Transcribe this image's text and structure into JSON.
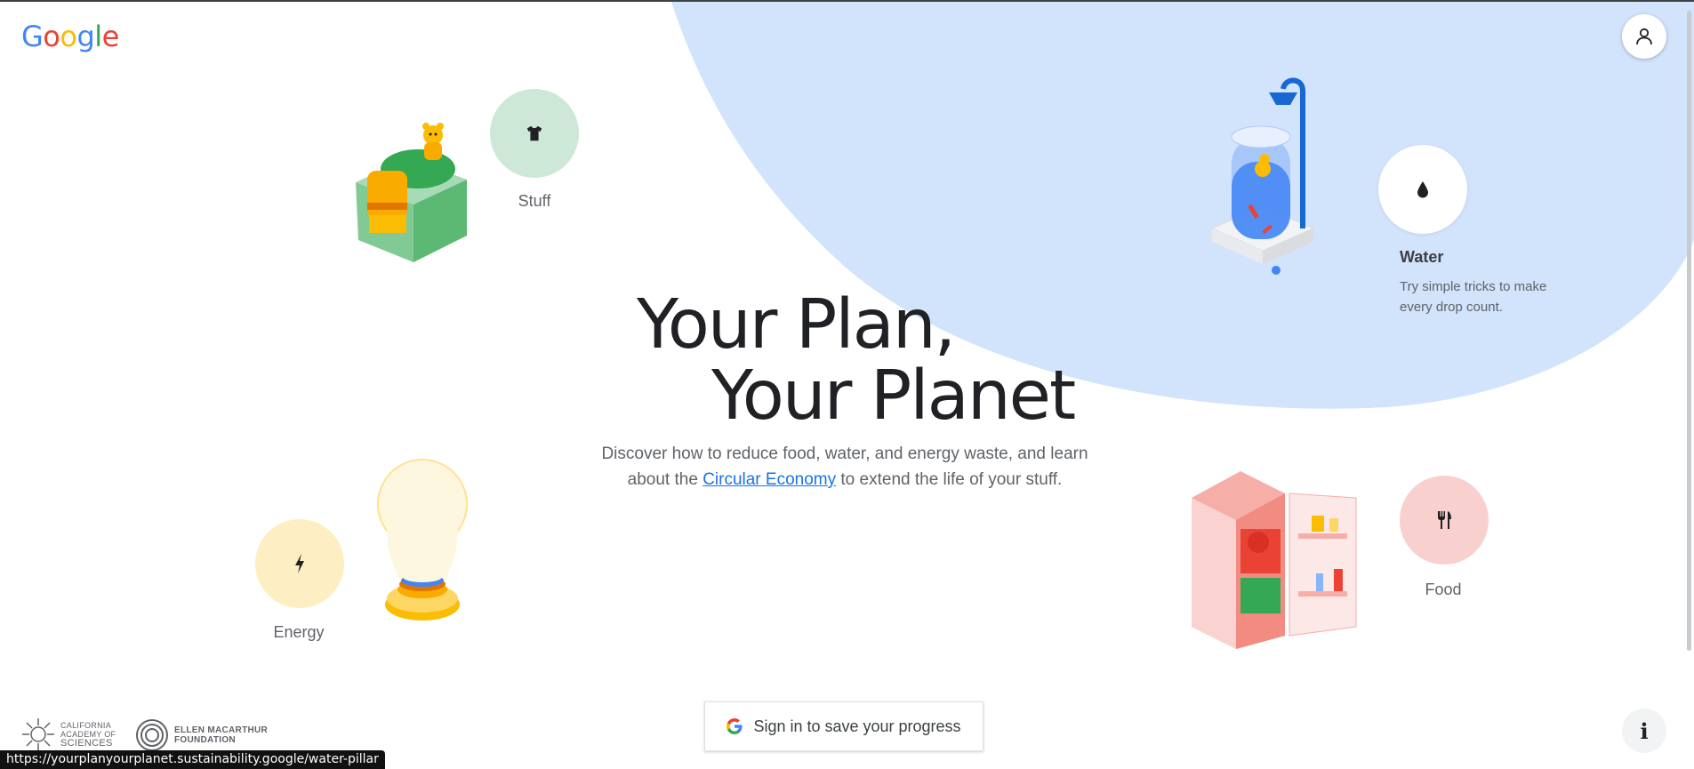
{
  "header": {
    "logo_letters": [
      "G",
      "o",
      "o",
      "g",
      "l",
      "e"
    ],
    "account_icon": "person-icon"
  },
  "hero": {
    "title_line1": "Your Plan,",
    "title_line2": "Your Planet",
    "subtitle_part1": "Discover how to reduce food, water, and energy waste, and learn about the ",
    "subtitle_link": "Circular Economy",
    "subtitle_part2": " to extend the life of your stuff."
  },
  "pillars": {
    "stuff": {
      "label": "Stuff",
      "icon": "shirt-icon",
      "color": "#cde8d6"
    },
    "water": {
      "label": "Water",
      "icon": "water-drop-icon",
      "description": "Try simple tricks to make every drop count.",
      "color": "#ffffff"
    },
    "energy": {
      "label": "Energy",
      "icon": "lightning-bolt-icon",
      "color": "#fdefc3"
    },
    "food": {
      "label": "Food",
      "icon": "fork-knife-icon",
      "color": "#f8d1cf"
    }
  },
  "signin": {
    "label": "Sign in to save your progress",
    "icon": "google-g-icon"
  },
  "partners": {
    "cas_lines": [
      "CALIFORNIA",
      "ACADEMY OF",
      "SCIENCES"
    ],
    "emf_lines": [
      "ELLEN MACARTHUR",
      "FOUNDATION"
    ]
  },
  "info_button": {
    "label": "i"
  },
  "status_bar": {
    "url": "https://yourplanyourplanet.sustainability.google/water-pillar"
  },
  "colors": {
    "accent_blue": "#1a73e8",
    "water_blob": "#d2e3fc"
  }
}
